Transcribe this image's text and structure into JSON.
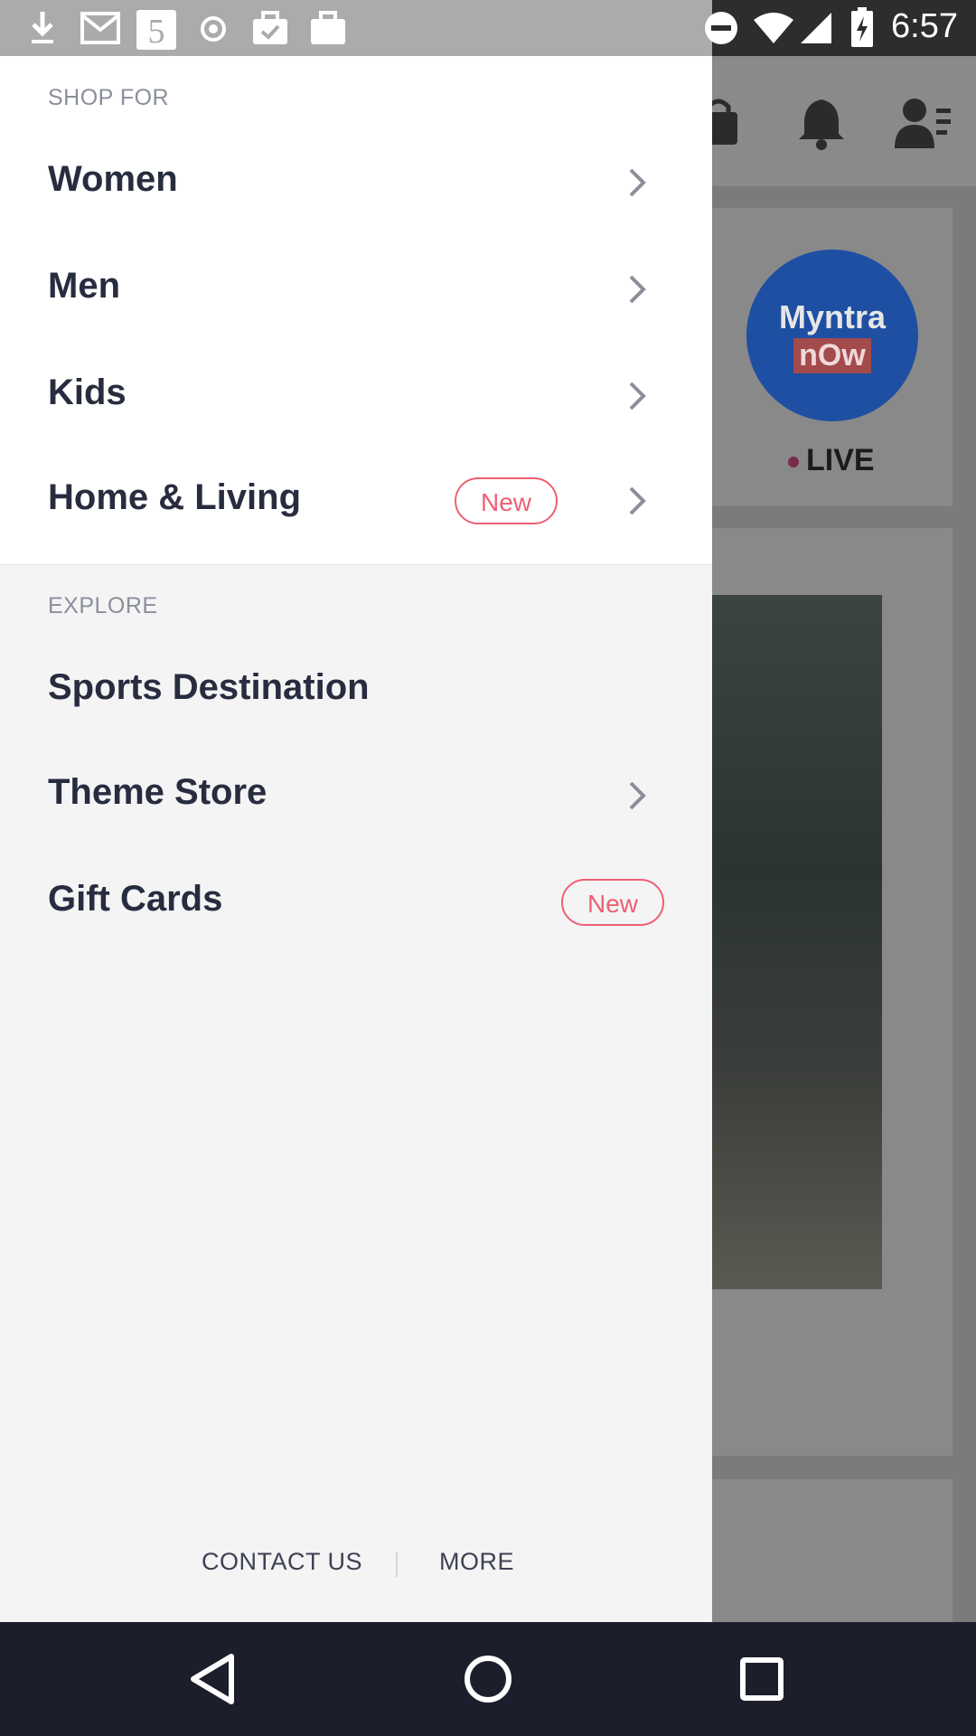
{
  "status_bar": {
    "time": "6:57",
    "left_icons": [
      "download-icon",
      "gmail-icon",
      "app-5-icon",
      "record-icon",
      "briefcase-check-icon",
      "briefcase-icon"
    ],
    "right_icons": [
      "do-not-disturb-icon",
      "wifi-icon",
      "signal-icon",
      "battery-charging-icon"
    ]
  },
  "background": {
    "badge_line1": "Myntra",
    "badge_line2": "nOw",
    "live_label": "LIVE",
    "header_icons": [
      "bag-icon",
      "bell-icon",
      "profile-icon"
    ]
  },
  "drawer": {
    "shop_for": {
      "label": "SHOP FOR",
      "items": [
        {
          "label": "Women",
          "chevron": true
        },
        {
          "label": "Men",
          "chevron": true
        },
        {
          "label": "Kids",
          "chevron": true
        },
        {
          "label": "Home & Living",
          "badge": "New",
          "chevron": true
        }
      ]
    },
    "explore": {
      "label": "EXPLORE",
      "items": [
        {
          "label": "Sports Destination"
        },
        {
          "label": "Theme Store",
          "chevron": true
        },
        {
          "label": "Gift Cards",
          "badge": "New"
        }
      ]
    },
    "footer": {
      "contact_us": "CONTACT US",
      "more": "MORE"
    }
  },
  "colors": {
    "accent": "#ee5f73",
    "text_primary": "#282c3f",
    "section_label": "#8a8f99",
    "navbar": "#1c1f2b"
  }
}
